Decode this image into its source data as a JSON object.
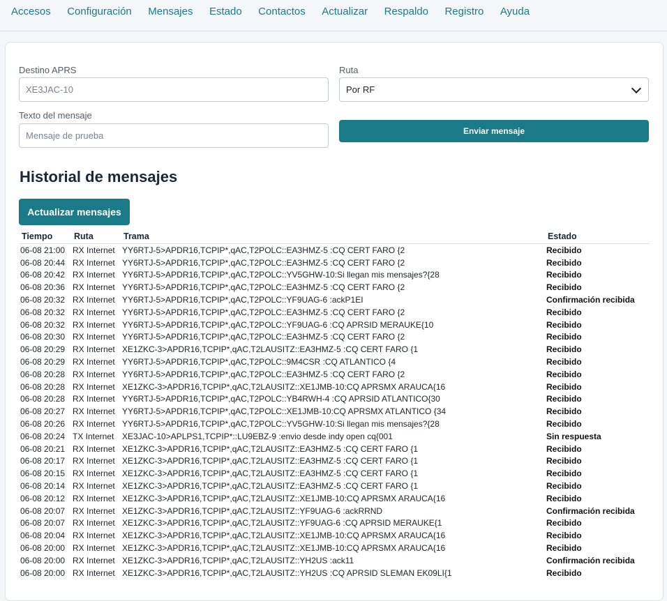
{
  "nav": [
    {
      "label": "Accesos"
    },
    {
      "label": "Configuración"
    },
    {
      "label": "Mensajes"
    },
    {
      "label": "Estado"
    },
    {
      "label": "Contactos"
    },
    {
      "label": "Actualizar"
    },
    {
      "label": "Respaldo"
    },
    {
      "label": "Registro"
    },
    {
      "label": "Ayuda"
    }
  ],
  "form": {
    "dest_label": "Destino APRS",
    "dest_placeholder": "XE3JAC-10",
    "route_label": "Ruta",
    "route_value": "Por RF",
    "text_label": "Texto del mensaje",
    "text_placeholder": "Mensaje de prueba",
    "send_label": "Enviar mensaje"
  },
  "history": {
    "title": "Historial de mensajes",
    "refresh_label": "Actualizar mensajes",
    "columns": [
      "Tiempo",
      "Ruta",
      "Trama",
      "Estado"
    ],
    "rows": [
      [
        "06-08 21:00",
        "RX Internet",
        "YY6RTJ-5>APDR16,TCPIP*,qAC,T2POLC::EA3HMZ-5 :CQ CERT FARO {2",
        "Recibido"
      ],
      [
        "06-08 20:44",
        "RX Internet",
        "YY6RTJ-5>APDR16,TCPIP*,qAC,T2POLC::EA3HMZ-5 :CQ CERT FARO {2",
        "Recibido"
      ],
      [
        "06-08 20:42",
        "RX Internet",
        "YY6RTJ-5>APDR16,TCPIP*,qAC,T2POLC::YV5GHW-10:Si llegan mis mensajes?{28",
        "Recibido"
      ],
      [
        "06-08 20:36",
        "RX Internet",
        "YY6RTJ-5>APDR16,TCPIP*,qAC,T2POLC::EA3HMZ-5 :CQ CERT FARO {2",
        "Recibido"
      ],
      [
        "06-08 20:32",
        "RX Internet",
        "YY6RTJ-5>APDR16,TCPIP*,qAC,T2POLC::YF9UAG-6 :ackP1EI",
        "Confirmación recibida"
      ],
      [
        "06-08 20:32",
        "RX Internet",
        "YY6RTJ-5>APDR16,TCPIP*,qAC,T2POLC::EA3HMZ-5 :CQ CERT FARO {2",
        "Recibido"
      ],
      [
        "06-08 20:32",
        "RX Internet",
        "YY6RTJ-5>APDR16,TCPIP*,qAC,T2POLC::YF9UAG-6 :CQ APRSID MERAUKE{10",
        "Recibido"
      ],
      [
        "06-08 20:30",
        "RX Internet",
        "YY6RTJ-5>APDR16,TCPIP*,qAC,T2POLC::EA3HMZ-5 :CQ CERT FARO {2",
        "Recibido"
      ],
      [
        "06-08 20:29",
        "RX Internet",
        "XE1ZKC-3>APDR16,TCPIP*,qAC,T2LAUSITZ::EA3HMZ-5 :CQ CERT FARO {1",
        "Recibido"
      ],
      [
        "06-08 20:29",
        "RX Internet",
        "YY6RTJ-5>APDR16,TCPIP*,qAC,T2POLC::9M4CSR :CQ ATLANTICO {4",
        "Recibido"
      ],
      [
        "06-08 20:28",
        "RX Internet",
        "YY6RTJ-5>APDR16,TCPIP*,qAC,T2POLC::EA3HMZ-5 :CQ CERT FARO {2",
        "Recibido"
      ],
      [
        "06-08 20:28",
        "RX Internet",
        "XE1ZKC-3>APDR16,TCPIP*,qAC,T2LAUSITZ::XE1JMB-10:CQ APRSMX ARAUCA{16",
        "Recibido"
      ],
      [
        "06-08 20:28",
        "RX Internet",
        "YY6RTJ-5>APDR16,TCPIP*,qAC,T2POLC::YB4RWH-4 :CQ APRSID ATLANTICO{30",
        "Recibido"
      ],
      [
        "06-08 20:27",
        "RX Internet",
        "YY6RTJ-5>APDR16,TCPIP*,qAC,T2POLC::XE1JMB-10:CQ APRSMX ATLANTICO {34",
        "Recibido"
      ],
      [
        "06-08 20:26",
        "RX Internet",
        "YY6RTJ-5>APDR16,TCPIP*,qAC,T2POLC::YV5GHW-10:Si llegan mis mensajes?{28",
        "Recibido"
      ],
      [
        "06-08 20:24",
        "TX Internet",
        "XE3JAC-10>APLPS1,TCPIP*::LU9EBZ-9 :envio desde indy open cq{001",
        "Sin respuesta"
      ],
      [
        "06-08 20:21",
        "RX Internet",
        "XE1ZKC-3>APDR16,TCPIP*,qAC,T2LAUSITZ::EA3HMZ-5 :CQ CERT FARO {1",
        "Recibido"
      ],
      [
        "06-08 20:17",
        "RX Internet",
        "XE1ZKC-3>APDR16,TCPIP*,qAC,T2LAUSITZ::EA3HMZ-5 :CQ CERT FARO {1",
        "Recibido"
      ],
      [
        "06-08 20:15",
        "RX Internet",
        "XE1ZKC-3>APDR16,TCPIP*,qAC,T2LAUSITZ::EA3HMZ-5 :CQ CERT FARO {1",
        "Recibido"
      ],
      [
        "06-08 20:14",
        "RX Internet",
        "XE1ZKC-3>APDR16,TCPIP*,qAC,T2LAUSITZ::EA3HMZ-5 :CQ CERT FARO {1",
        "Recibido"
      ],
      [
        "06-08 20:12",
        "RX Internet",
        "XE1ZKC-3>APDR16,TCPIP*,qAC,T2LAUSITZ::XE1JMB-10:CQ APRSMX ARAUCA{16",
        "Recibido"
      ],
      [
        "06-08 20:07",
        "RX Internet",
        "XE1ZKC-3>APDR16,TCPIP*,qAC,T2LAUSITZ::YF9UAG-6 :ackRRND",
        "Confirmación recibida"
      ],
      [
        "06-08 20:07",
        "RX Internet",
        "XE1ZKC-3>APDR16,TCPIP*,qAC,T2LAUSITZ::YF9UAG-6 :CQ APRSID MERAUKE{1",
        "Recibido"
      ],
      [
        "06-08 20:04",
        "RX Internet",
        "XE1ZKC-3>APDR16,TCPIP*,qAC,T2LAUSITZ::XE1JMB-10:CQ APRSMX ARAUCA{16",
        "Recibido"
      ],
      [
        "06-08 20:00",
        "RX Internet",
        "XE1ZKC-3>APDR16,TCPIP*,qAC,T2LAUSITZ::XE1JMB-10:CQ APRSMX ARAUCA{16",
        "Recibido"
      ],
      [
        "06-08 20:00",
        "RX Internet",
        "XE1ZKC-3>APDR16,TCPIP*,qAC,T2LAUSITZ::YH2US :ack11",
        "Confirmación recibida"
      ],
      [
        "06-08 20:00",
        "RX Internet",
        "XE1ZKC-3>APDR16,TCPIP*,qAC,T2LAUSITZ::YH2US :CQ APRSID SLEMAN EK09LI{1",
        "Recibido"
      ]
    ]
  }
}
